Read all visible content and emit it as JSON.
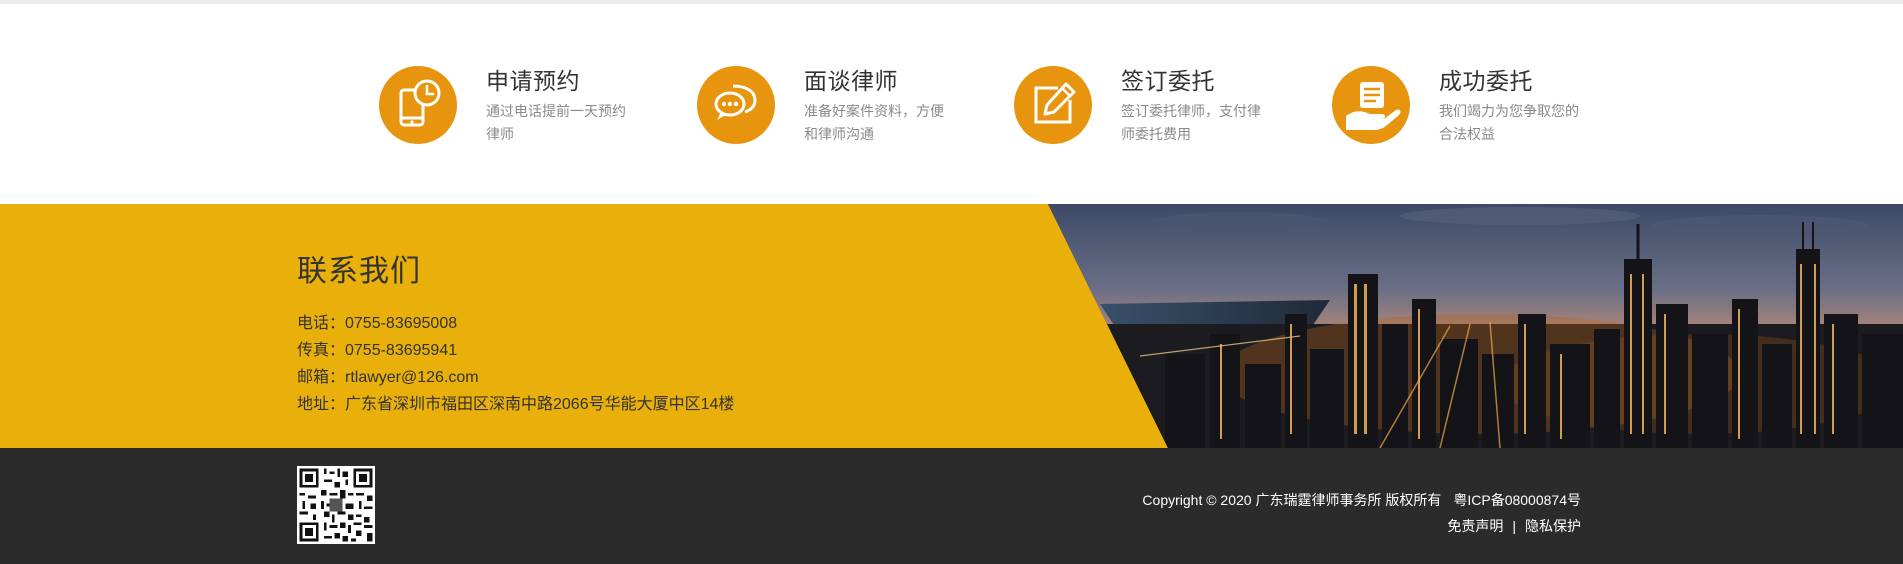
{
  "steps": [
    {
      "title": "申请预约",
      "desc": "通过电话提前一天预约律师",
      "icon": "phone-clock-icon"
    },
    {
      "title": "面谈律师",
      "desc": "准备好案件资料，方便和律师沟通",
      "icon": "chat-bubbles-icon"
    },
    {
      "title": "签订委托",
      "desc": "签订委托律师，支付律师委托费用",
      "icon": "edit-pen-icon"
    },
    {
      "title": "成功委托",
      "desc": "我们竭力为您争取您的合法权益",
      "icon": "hand-document-icon"
    }
  ],
  "contact": {
    "title": "联系我们",
    "phone": "电话：0755-83695008",
    "fax": "传真：0755-83695941",
    "email": "邮箱：rtlawyer@126.com",
    "address": "地址：广东省深圳市福田区深南中路2066号华能大厦中区14楼"
  },
  "footer": {
    "copyright": "Copyright © 2020 广东瑞霆律师事务所 版权所有",
    "icp": "粤ICP备08000874号",
    "disclaimer": "免责声明",
    "separator": "|",
    "privacy": "隐私保护"
  },
  "colors": {
    "accent": "#e7950e",
    "band": "#e9b00b",
    "footer_bg": "#2c2b2c"
  }
}
